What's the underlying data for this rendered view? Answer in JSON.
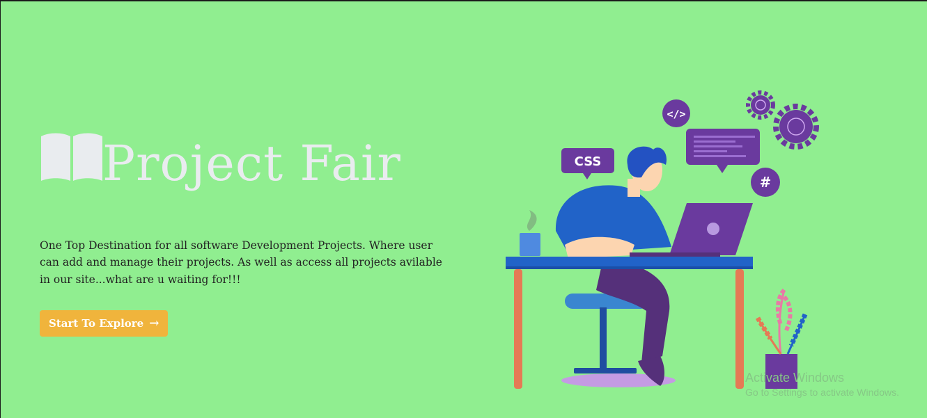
{
  "hero": {
    "icon": "book-open-icon",
    "title": "Project Fair",
    "description": "One Top Destination for all software Development Projects. Where user can add and manage their projects. As well as access all projects avilable in our site...what are u waiting for!!!",
    "button": {
      "label": "Start To Explore",
      "icon": "arrow-right-icon"
    }
  },
  "illustration": {
    "css_tag": "CSS",
    "code_tag": "</>",
    "hash_tag": "#"
  },
  "watermark": {
    "title": "Activate Windows",
    "subtitle": "Go to Settings to activate Windows."
  },
  "colors": {
    "background": "#90ee90",
    "button": "#f0b43c",
    "title": "#e9ecef",
    "accent_purple": "#6a3a9e",
    "accent_blue": "#2163c8"
  }
}
